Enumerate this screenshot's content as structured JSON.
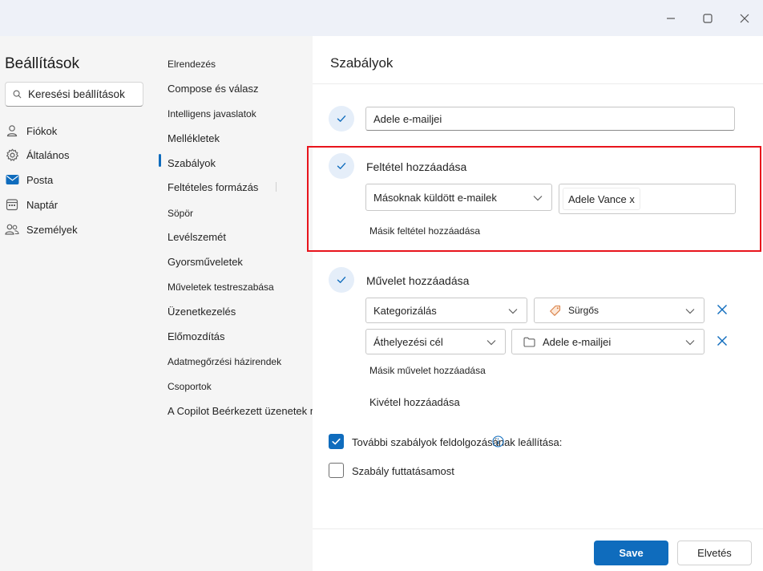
{
  "window": {
    "controls": [
      "minimize-icon",
      "maximize-icon",
      "close-icon"
    ]
  },
  "sidebar": {
    "title": "Beállítások",
    "search_placeholder": "Keresési beállítások",
    "categories": [
      {
        "label": "Fiókok",
        "icon": "person-icon"
      },
      {
        "label": "Általános",
        "icon": "gear-icon"
      },
      {
        "label": "Posta",
        "icon": "mail-icon"
      },
      {
        "label": "Naptár",
        "icon": "calendar-icon"
      },
      {
        "label": "Személyek",
        "icon": "people-icon"
      }
    ]
  },
  "submenu": {
    "selected": "Szabályok",
    "items": [
      "Elrendezés",
      "Compose és válasz",
      "Intelligens javaslatok",
      "Mellékletek",
      "Szabályok",
      "Feltételes formázás",
      "Söpör",
      "Levélszemét",
      "Gyorsműveletek",
      "Műveletek testreszabása",
      "Üzenetkezelés",
      "Előmozdítás",
      "Adatmegőrzési házirendek",
      "Csoportok",
      "A Copilot Beérkezett üzenetek mappája"
    ]
  },
  "panel": {
    "title": "Szabályok",
    "rule_name": "Adele e-mailjei",
    "condition": {
      "heading": "Feltétel hozzáadása",
      "dropdown_value": "Másoknak küldött e-mailek",
      "chip": "Adele Vance x",
      "add_another": "Másik feltétel hozzáadása"
    },
    "action": {
      "heading": "Művelet hozzáadása",
      "rows": [
        {
          "action": "Kategorizálás",
          "value": "Sürgős",
          "value_icon": "tag-icon"
        },
        {
          "action": "Áthelyezési cél",
          "value": "Adele e-mailjei",
          "value_icon": "folder-icon"
        }
      ],
      "add_another": "Másik művelet hozzáadása"
    },
    "exception": "Kivétel hozzáadása",
    "options": [
      {
        "label": "További szabályok feldolgozásának leállítása:",
        "checked": true
      },
      {
        "label": "Szabály futtatásamost",
        "checked": false
      }
    ]
  },
  "footer": {
    "save": "Save",
    "discard": "Elvetés"
  },
  "colors": {
    "accent": "#0f6cbd",
    "highlight": "#e8141c",
    "check_circle_bg": "#e5eef9",
    "remove_x": "#0f6cbd"
  }
}
